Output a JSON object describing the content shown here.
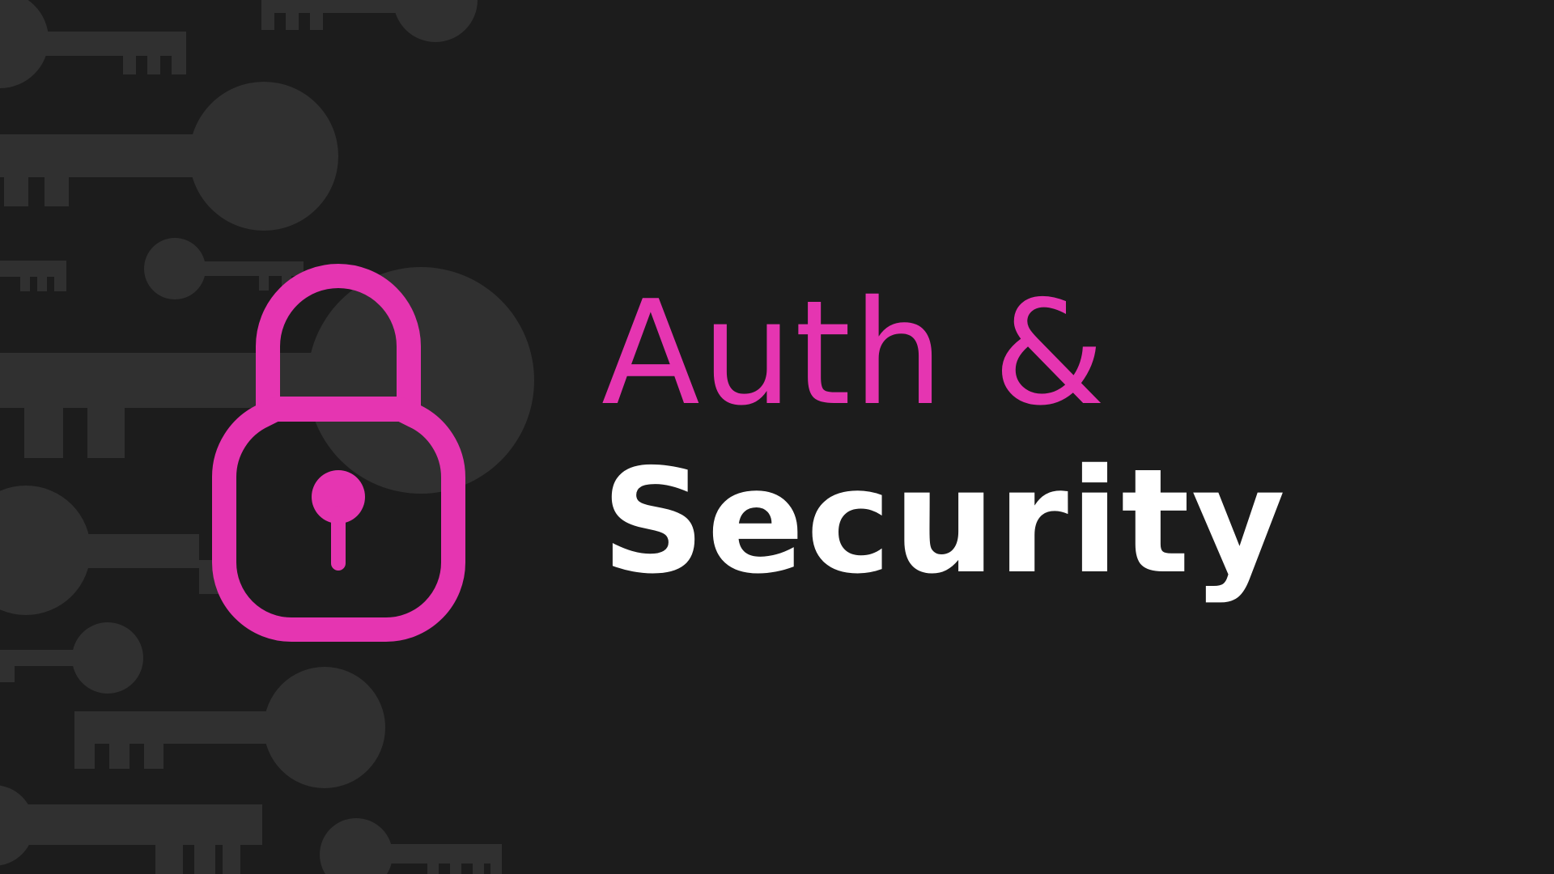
{
  "title": {
    "line1": "Auth &",
    "line2": "Security"
  },
  "colors": {
    "background": "#1c1c1c",
    "key_pattern": "#303030",
    "accent": "#e535b1",
    "text_light": "#ffffff"
  },
  "icons": {
    "main": "padlock-icon",
    "background_pattern": "key-icon"
  }
}
